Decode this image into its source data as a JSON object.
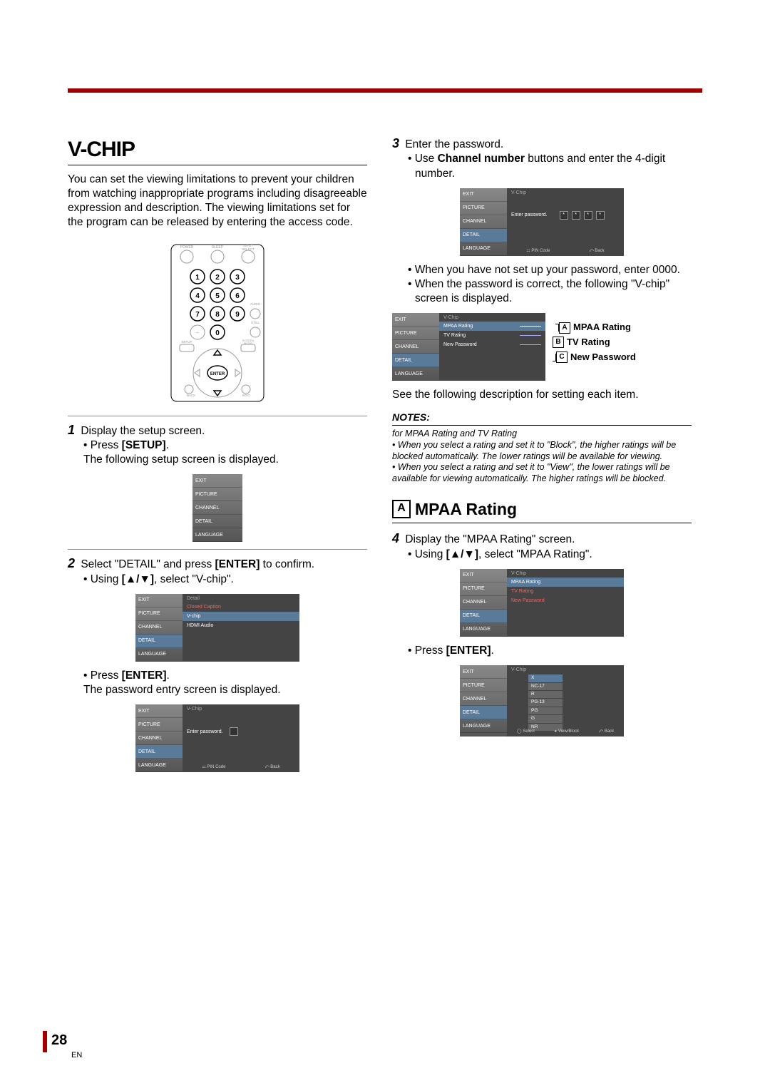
{
  "header": {
    "title": "V-CHIP"
  },
  "intro": "You can set the viewing limitations to prevent your children from watching inappropriate programs including disagreeable expression and description. The viewing limitations set for the program can be released by entering the access code.",
  "remote": {
    "top_labels": [
      "POWER",
      "SLEEP",
      "INPUT SELECT"
    ],
    "side_labels": [
      "AUDIO",
      "STILL",
      "SCREEN MODE",
      "INFO",
      "BACK",
      "SETUP"
    ],
    "enter": "ENTER"
  },
  "steps": {
    "s1": {
      "num": "1",
      "text": "Display the setup screen.",
      "b1": "• Press ",
      "b1_key": "[SETUP]",
      "b1_tail": ".",
      "b1_after": "The following setup screen is displayed."
    },
    "s2": {
      "num": "2",
      "text_a": "Select \"DETAIL\" and press ",
      "text_key": "[ENTER]",
      "text_b": " to confirm.",
      "b1": "• Using ",
      "b1_key": "[▲/▼]",
      "b1_tail": ", select \"V-chip\".",
      "b2": "• Press ",
      "b2_key": "[ENTER]",
      "b2_tail": ".",
      "b2_after": "The password entry screen is displayed."
    },
    "s3": {
      "num": "3",
      "text": "Enter the password.",
      "b1": "• Use ",
      "b1_key": "Channel number",
      "b1_tail": " buttons and enter the 4-digit number.",
      "b2": "• When you have not set up your password, enter 0000.",
      "b3": "• When the password is correct, the following \"V-chip\" screen is displayed."
    },
    "s3_after": "See the following description for setting each item.",
    "s4": {
      "num": "4",
      "text": "Display the \"MPAA Rating\" screen.",
      "b1": "• Using ",
      "b1_key": "[▲/▼]",
      "b1_tail": ", select \"MPAA Rating\".",
      "b2": "• Press ",
      "b2_key": "[ENTER]",
      "b2_tail": "."
    }
  },
  "menus": {
    "sidebar": [
      "EXIT",
      "PICTURE",
      "CHANNEL",
      "DETAIL",
      "LANGUAGE"
    ],
    "detail_title": "Detail",
    "detail_items": [
      "Closed Caption",
      "V-chip",
      "HDMI Audio"
    ],
    "vchip_title": "V-Chip",
    "enter_pwd": "Enter password.",
    "pin_code": "PIN Code",
    "back": "Back",
    "select": "Select",
    "viewblock": "View/Block",
    "vchip_items": [
      "MPAA Rating",
      "TV Rating",
      "New Password"
    ],
    "mpaa_list": [
      "X",
      "NC-17",
      "R",
      "PG-13",
      "PG",
      "G",
      "NR"
    ]
  },
  "legend": {
    "a": "MPAA Rating",
    "b": "TV Rating",
    "c": "New Password"
  },
  "subhead": {
    "letter": "A",
    "title": "MPAA Rating"
  },
  "notes": {
    "hdr": "NOTES:",
    "sub": "for MPAA Rating and TV Rating",
    "n1": "• When you select a rating and set it to \"Block\", the higher ratings will be blocked automatically. The lower ratings will be available for viewing.",
    "n2": "• When you select a rating and set it to \"View\", the lower ratings will be available for viewing automatically. The higher ratings will be blocked."
  },
  "footer": {
    "page": "28",
    "lang": "EN"
  }
}
